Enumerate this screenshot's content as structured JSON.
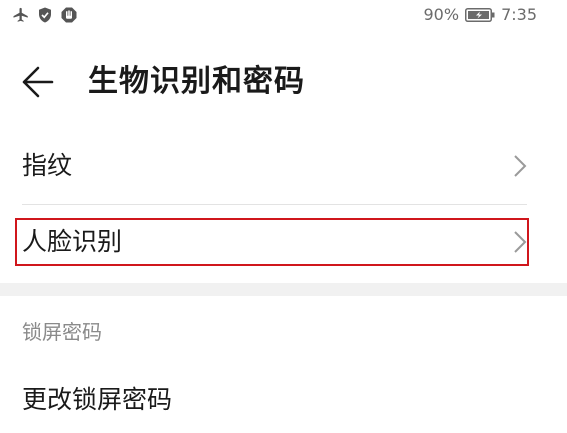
{
  "status_bar": {
    "icons": [
      "airplane-mode-icon",
      "shield-check-icon",
      "hand-stop-icon"
    ],
    "battery_percent": "90%",
    "battery_icon": "battery-icon",
    "time": "7:35"
  },
  "header": {
    "back_icon": "back-arrow-icon",
    "title": "生物识别和密码"
  },
  "list": {
    "items": [
      {
        "label": "指纹",
        "icon": "chevron-right-icon"
      },
      {
        "label": "人脸识别",
        "icon": "chevron-right-icon",
        "highlighted": true
      }
    ]
  },
  "lock_section": {
    "header": "锁屏密码",
    "items": [
      {
        "label": "更改锁屏密码"
      }
    ]
  },
  "colors": {
    "highlight_border": "#d0161c",
    "section_band": "#f1f1f1",
    "divider": "#e3e3e3",
    "secondary_text": "#8a8a8a"
  }
}
